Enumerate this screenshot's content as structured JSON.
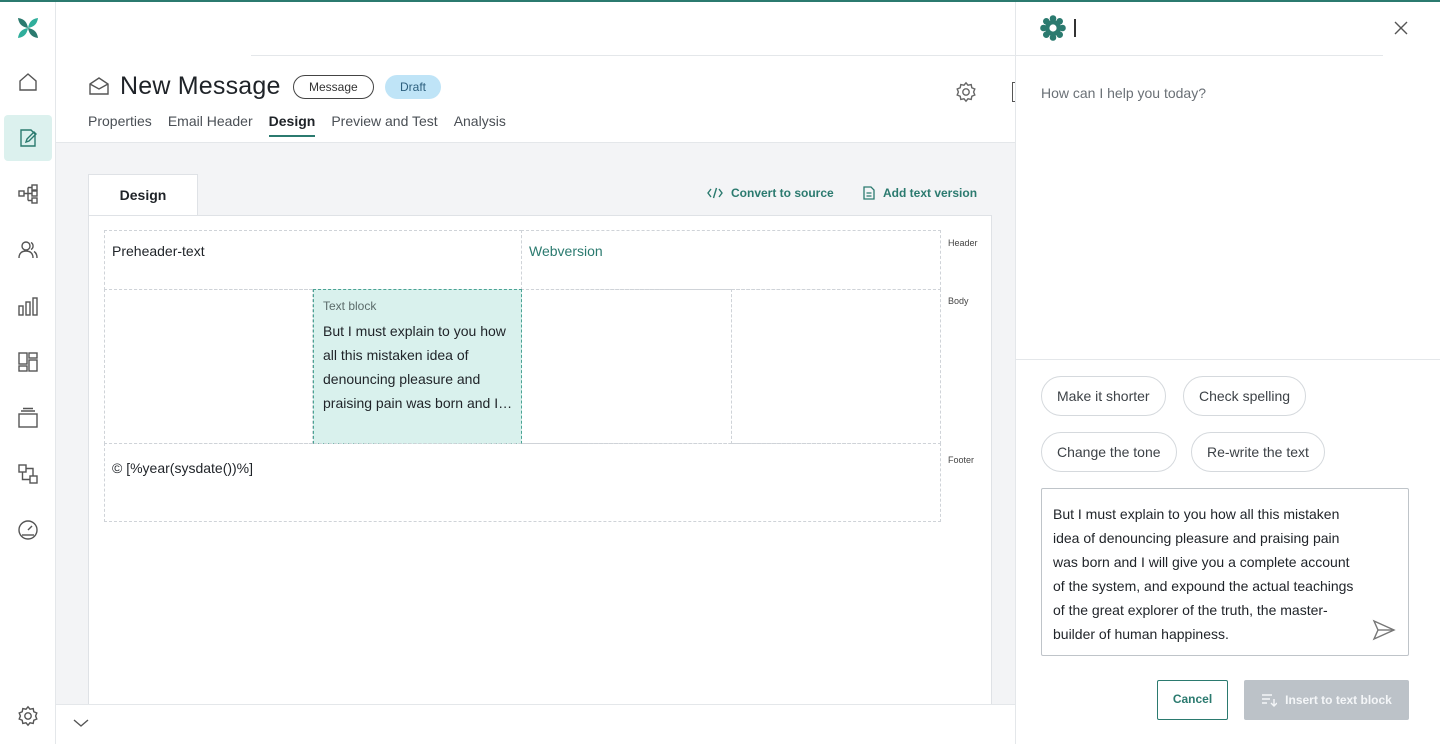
{
  "colors": {
    "accent": "#2b7a6f",
    "selected_bg": "#d9f1ed",
    "draft_bg": "#bfe4f7",
    "disabled": "#bcc2c8"
  },
  "rail": {
    "items": [
      {
        "icon": "home-icon"
      },
      {
        "icon": "edit-message-icon",
        "active": true
      },
      {
        "icon": "flow-icon"
      },
      {
        "icon": "contacts-icon"
      },
      {
        "icon": "analytics-icon"
      },
      {
        "icon": "dashboard-icon"
      },
      {
        "icon": "archive-icon"
      },
      {
        "icon": "integrations-icon"
      },
      {
        "icon": "speed-icon"
      }
    ],
    "bottom_icon": "settings-icon"
  },
  "header": {
    "title": "New Message",
    "type_badge": "Message",
    "status_badge": "Draft",
    "tabs": [
      {
        "label": "Properties"
      },
      {
        "label": "Email Header"
      },
      {
        "label": "Design",
        "active": true
      },
      {
        "label": "Preview and Test"
      },
      {
        "label": "Analysis"
      }
    ]
  },
  "editor": {
    "tab_label": "Design",
    "convert_label": "Convert to source",
    "add_text_label": "Add text version",
    "zones": {
      "header": "Header",
      "body": "Body",
      "footer": "Footer"
    },
    "preheader": "Preheader-text",
    "webversion": "Webversion",
    "text_block_label": "Text block",
    "text_block_content": "But I must explain to you how all this mistaken idea of denouncing pleasure and praising pain was born and I will give you a complete account of the system",
    "footer_text": "© [%year(sysdate())%]"
  },
  "ai": {
    "prompt": "How can I help you today?",
    "suggestions": [
      "Make it shorter",
      "Check spelling",
      "Change the tone",
      "Re-write the text"
    ],
    "input_text": "But I must explain to you how all this mistaken idea of denouncing pleasure and praising pain was born and I will give you a complete account of the system, and expound the actual teachings of the great explorer of the truth, the master-builder of human happiness.",
    "cancel_label": "Cancel",
    "insert_label": "Insert to text block"
  }
}
